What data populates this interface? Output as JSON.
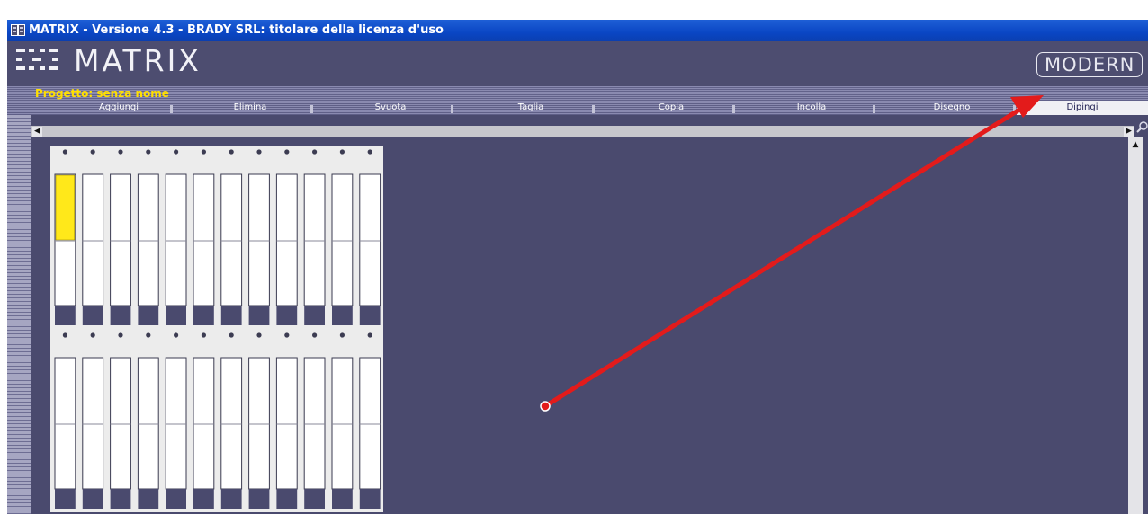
{
  "window": {
    "title": "MATRIX - Versione 4.3 - BRADY SRL: titolare della licenza d'uso",
    "icon": "matrix-app-icon"
  },
  "header": {
    "logo_text": "MATRIX",
    "brand_label": "MODERN"
  },
  "project": {
    "name": "Progetto: senza nome"
  },
  "toolbar": {
    "items": [
      {
        "label": "Aggiungi"
      },
      {
        "label": "Elimina"
      },
      {
        "label": "Svuota"
      },
      {
        "label": "Taglia"
      },
      {
        "label": "Copia"
      },
      {
        "label": "Incolla"
      },
      {
        "label": "Disegno"
      },
      {
        "label": "Dipingi",
        "active": true
      }
    ]
  },
  "scrollbars": {
    "left_arrow": "◀",
    "right_arrow": "▶",
    "up_arrow": "▲"
  },
  "canvas": {
    "panels": [
      {
        "columns": 12,
        "highlighted_column": 1,
        "highlight_color": "#ffe81a"
      },
      {
        "columns": 12,
        "highlighted_column": null
      }
    ]
  },
  "annotation": {
    "type": "arrow",
    "color": "#e31b1b",
    "points_to": "Dipingi"
  },
  "colors": {
    "background": "#4a4a6e",
    "titlebar": "#0a46c4",
    "project_text": "#ffe000",
    "active_tab": "#f0f0f4"
  }
}
